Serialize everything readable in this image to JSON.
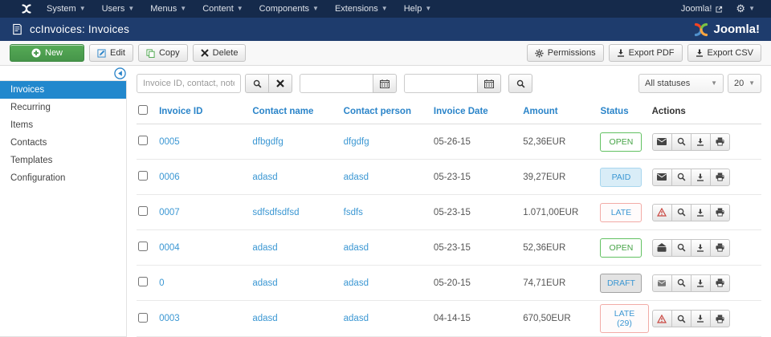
{
  "menubar": {
    "items": [
      "System",
      "Users",
      "Menus",
      "Content",
      "Components",
      "Extensions",
      "Help"
    ],
    "site_link_label": "Joomla!"
  },
  "header": {
    "title": "ccInvoices: Invoices",
    "brand": "Joomla!"
  },
  "toolbar": {
    "new_label": "New",
    "edit_label": "Edit",
    "copy_label": "Copy",
    "delete_label": "Delete",
    "permissions_label": "Permissions",
    "export_pdf_label": "Export PDF",
    "export_csv_label": "Export CSV"
  },
  "sidebar": {
    "items": [
      "Invoices",
      "Recurring",
      "Items",
      "Contacts",
      "Templates",
      "Configuration"
    ],
    "active_item": "Invoices"
  },
  "filters": {
    "search_placeholder": "Invoice ID, contact, note etc.",
    "date_from_value": "",
    "date_to_value": "",
    "status_filter_value": "All statuses",
    "limit_value": "20"
  },
  "table": {
    "headers": [
      "Invoice ID",
      "Contact name",
      "Contact person",
      "Invoice Date",
      "Amount",
      "Status",
      "Actions"
    ],
    "rows": [
      {
        "invoice_id": "0005",
        "contact_name": "dfbgdfg",
        "contact_person": "dfgdfg",
        "invoice_date": "05-26-15",
        "amount": "52,36EUR",
        "status": "OPEN",
        "status_type": "open",
        "first_action": "envelope"
      },
      {
        "invoice_id": "0006",
        "contact_name": "adasd",
        "contact_person": "adasd",
        "invoice_date": "05-23-15",
        "amount": "39,27EUR",
        "status": "PAID",
        "status_type": "paid",
        "first_action": "envelope"
      },
      {
        "invoice_id": "0007",
        "contact_name": "sdfsdfsdfsd",
        "contact_person": "fsdfs",
        "invoice_date": "05-23-15",
        "amount": "1.071,00EUR",
        "status": "LATE",
        "status_type": "late",
        "first_action": "warning"
      },
      {
        "invoice_id": "0004",
        "contact_name": "adasd",
        "contact_person": "adasd",
        "invoice_date": "05-23-15",
        "amount": "52,36EUR",
        "status": "OPEN",
        "status_type": "open",
        "first_action": "envelope-open"
      },
      {
        "invoice_id": "0",
        "contact_name": "adasd",
        "contact_person": "adasd",
        "invoice_date": "05-20-15",
        "amount": "74,71EUR",
        "status": "DRAFT",
        "status_type": "draft",
        "first_action": "envelope"
      },
      {
        "invoice_id": "0003",
        "contact_name": "adasd",
        "contact_person": "adasd",
        "invoice_date": "04-14-15",
        "amount": "670,50EUR",
        "status": "LATE (29)",
        "status_type": "late",
        "first_action": "warning"
      }
    ]
  },
  "icons": {
    "joomla-logo": "four-color interlocking X mark",
    "search": "magnifier",
    "clear": "x-cross",
    "calendar": "calendar grid",
    "envelope": "closed envelope",
    "envelope-open": "opened envelope",
    "warning": "red triangle exclamation",
    "download": "down arrow to bar",
    "print": "printer",
    "gear": "cogwheel",
    "collapse": "left arrow in circle"
  },
  "colors": {
    "menubar_bg": "#152a4b",
    "header_bg": "#1e3c6d",
    "accent_link": "#2a84c9",
    "sidebar_active_bg": "#2288cd",
    "open_green": "#47a447",
    "paid_blue": "#3b97d3",
    "late_border": "#f2aba6",
    "draft_bg": "#e3e3e3",
    "new_button_green": "#46954a"
  }
}
